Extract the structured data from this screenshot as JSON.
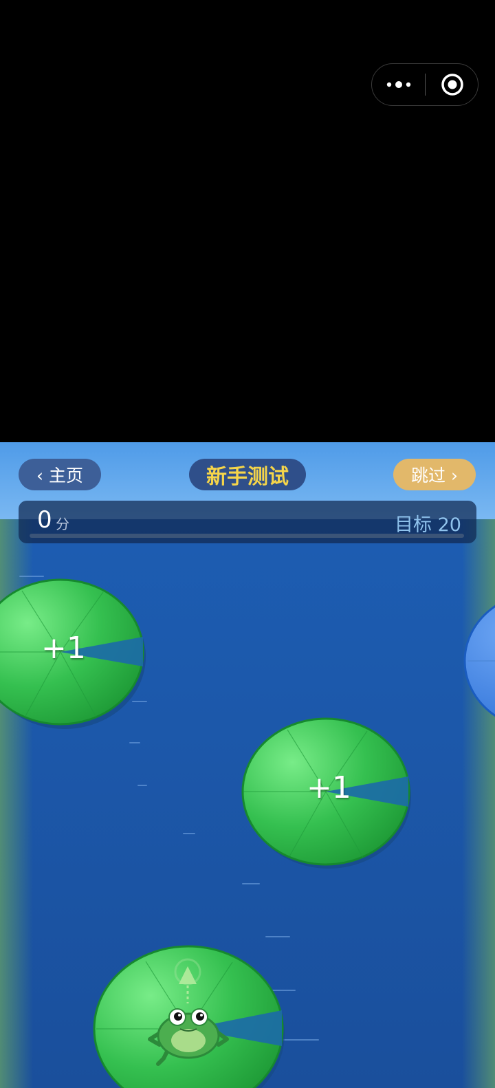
{
  "capsule": {
    "more_icon": "more-dots-icon",
    "close_icon": "target-close-icon"
  },
  "header": {
    "home_label": "‹ 主页",
    "title": "新手测试",
    "skip_label": "跳过 ›"
  },
  "scorebar": {
    "score": "0",
    "unit": "分",
    "target_label": "目标 20",
    "progress": 0
  },
  "pads": [
    {
      "label": "+1"
    },
    {
      "label": "+1"
    }
  ],
  "colors": {
    "accent_yellow": "#f5d54a",
    "skip_gold": "#e2b86a",
    "water": "#1a56a8",
    "pad_green": "#2fb848"
  },
  "icons": [
    "more-dots-icon",
    "target-close-icon",
    "frog-icon",
    "jump-arrow-icon"
  ]
}
